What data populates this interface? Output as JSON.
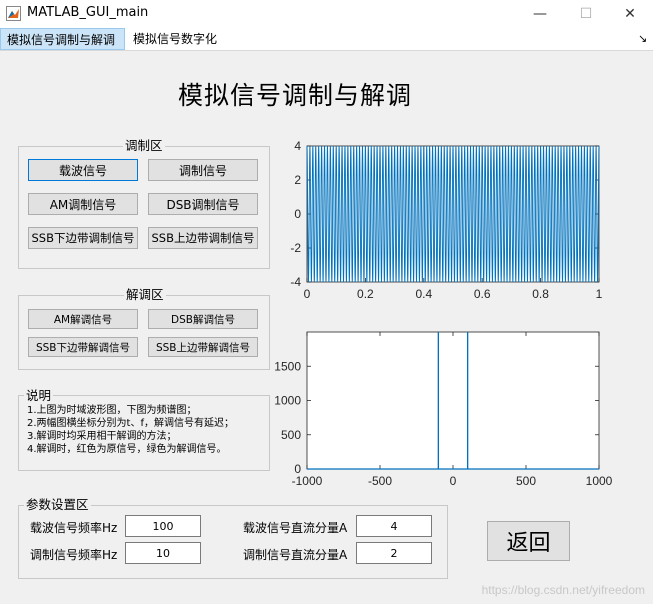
{
  "window": {
    "title": "MATLAB_GUI_main",
    "minimize": "—",
    "maximize": "☐",
    "close": "✕"
  },
  "tabs": [
    {
      "label": "模拟信号调制与解调",
      "active": true
    },
    {
      "label": "模拟信号数字化",
      "active": false
    }
  ],
  "tab_overflow": "↘",
  "heading": "模拟信号调制与解调",
  "modulation_panel": {
    "title": "调制区",
    "buttons": [
      "载波信号",
      "调制信号",
      "AM调制信号",
      "DSB调制信号",
      "SSB下边带调制信号",
      "SSB上边带调制信号"
    ]
  },
  "demodulation_panel": {
    "title": "解调区",
    "buttons": [
      "AM解调信号",
      "DSB解调信号",
      "SSB下边带解调信号",
      "SSB上边带解调信号"
    ]
  },
  "notes_panel": {
    "title": "说明",
    "lines": [
      "1.上图为时域波形图，下图为频谱图；",
      "2.两幅图横坐标分别为t、f，解调信号有延迟；",
      "3.解调时均采用相干解调的方法；",
      "4.解调时，红色为原信号，绿色为解调信号。"
    ]
  },
  "params_panel": {
    "title": "参数设置区",
    "carrier_freq_label": "载波信号频率Hz",
    "carrier_freq_value": "100",
    "mod_freq_label": "调制信号频率Hz",
    "mod_freq_value": "10",
    "carrier_dc_label": "载波信号直流分量A",
    "carrier_dc_value": "4",
    "mod_dc_label": "调制信号直流分量A",
    "mod_dc_value": "2"
  },
  "back_button": "返回",
  "watermark": "https://blog.csdn.net/yifreedom",
  "colors": {
    "line": "#0072bd",
    "active_tab": "#cce4f7"
  },
  "chart_data": [
    {
      "type": "line",
      "description_series": "carrier wave 4*cos(2*pi*100*t)",
      "x_ticks": [
        "0",
        "0.2",
        "0.4",
        "0.6",
        "0.8",
        "1"
      ],
      "y_ticks": [
        "-4",
        "-2",
        "0",
        "2",
        "4"
      ],
      "xlim": [
        0,
        1
      ],
      "ylim": [
        -4,
        4
      ],
      "amplitude": 4,
      "frequency": 100
    },
    {
      "type": "line",
      "x_ticks": [
        "-1000",
        "-500",
        "0",
        "500",
        "1000"
      ],
      "y_ticks": [
        "0",
        "500",
        "1000",
        "1500"
      ],
      "xlim": [
        -1000,
        1000
      ],
      "ylim": [
        0,
        2000
      ],
      "spikes": [
        {
          "x": -100,
          "y": 2000
        },
        {
          "x": 100,
          "y": 2000
        }
      ]
    }
  ]
}
